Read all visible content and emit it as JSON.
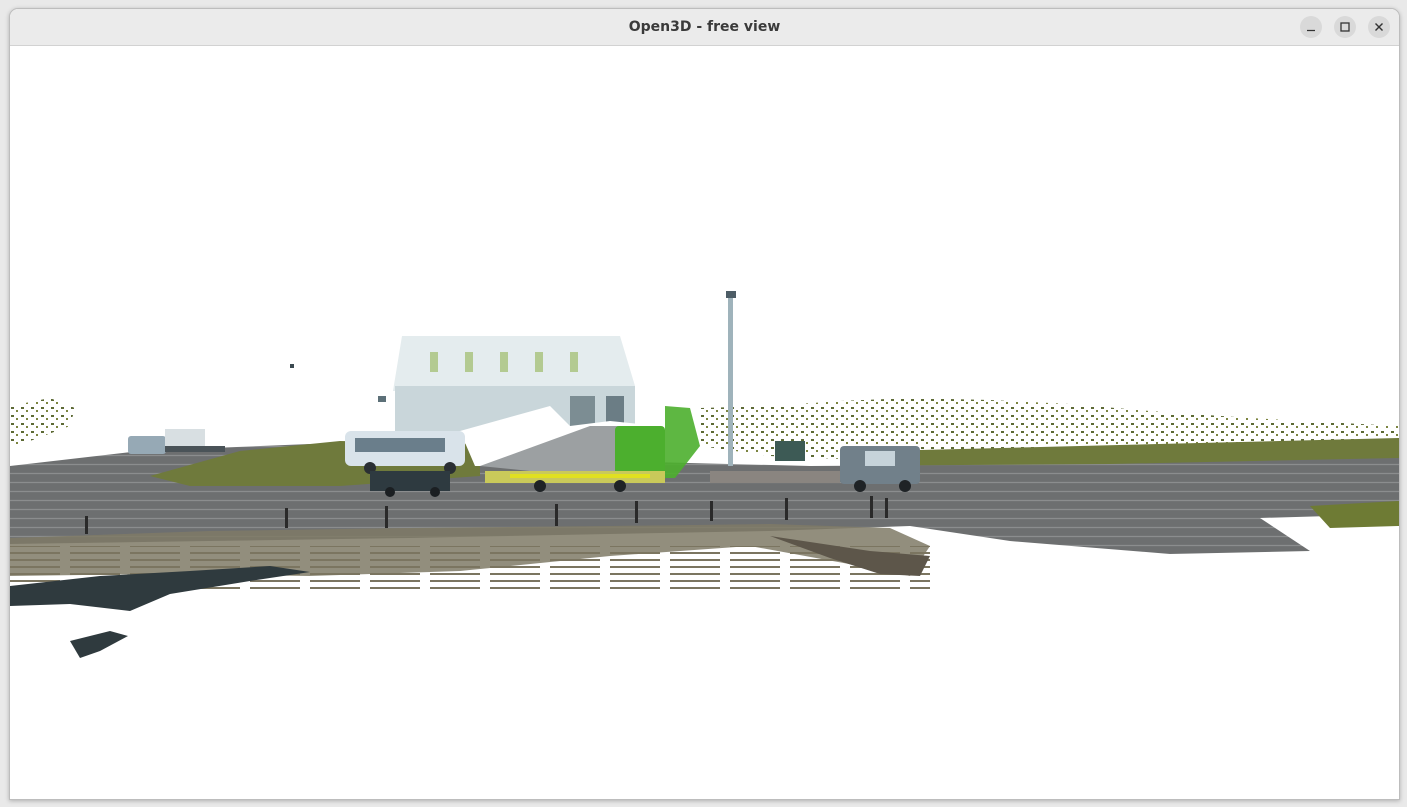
{
  "window": {
    "title": "Open3D - free view",
    "controls": {
      "minimize_icon": "minimize-icon",
      "maximize_icon": "maximize-icon",
      "close_icon": "close-icon"
    }
  },
  "viewport": {
    "background_color": "#ffffff",
    "content": "point-cloud",
    "colors": {
      "road": "#6d6f70",
      "grass": "#6f7a3c",
      "building": "#dde6e8",
      "truck_green": "#4caf2e",
      "dark_points": "#2f3a3e"
    }
  }
}
